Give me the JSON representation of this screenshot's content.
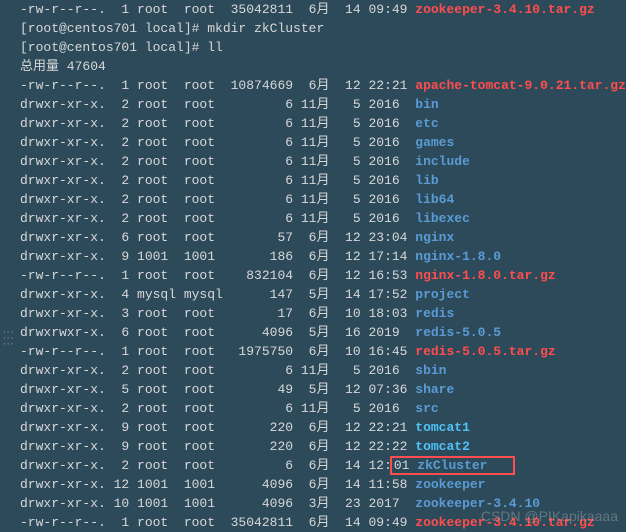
{
  "top_lines": [
    {
      "perms": "-rw-r--r--.",
      "links": "1",
      "owner": "root",
      "group": "root",
      "size": "35042811",
      "month": "6月",
      "day": "14",
      "time": "09:49",
      "name": "zookeeper-3.4.10.tar.gz",
      "cls": "red"
    }
  ],
  "commands": [
    {
      "prompt": "[root@centos701 local]# ",
      "cmd": "mkdir zkCluster"
    },
    {
      "prompt": "[root@centos701 local]# ",
      "cmd": "ll"
    }
  ],
  "total": "总用量 47604",
  "entries": [
    {
      "perms": "-rw-r--r--.",
      "links": "1",
      "owner": "root",
      "group": "root",
      "size": "10874669",
      "month": "6月",
      "day": "12",
      "time": "22:21",
      "name": "apache-tomcat-9.0.21.tar.gz",
      "cls": "red"
    },
    {
      "perms": "drwxr-xr-x.",
      "links": "2",
      "owner": "root",
      "group": "root",
      "size": "6",
      "month": "11月",
      "day": "5",
      "time": "2016",
      "name": "bin",
      "cls": "blue"
    },
    {
      "perms": "drwxr-xr-x.",
      "links": "2",
      "owner": "root",
      "group": "root",
      "size": "6",
      "month": "11月",
      "day": "5",
      "time": "2016",
      "name": "etc",
      "cls": "blue"
    },
    {
      "perms": "drwxr-xr-x.",
      "links": "2",
      "owner": "root",
      "group": "root",
      "size": "6",
      "month": "11月",
      "day": "5",
      "time": "2016",
      "name": "games",
      "cls": "blue"
    },
    {
      "perms": "drwxr-xr-x.",
      "links": "2",
      "owner": "root",
      "group": "root",
      "size": "6",
      "month": "11月",
      "day": "5",
      "time": "2016",
      "name": "include",
      "cls": "blue"
    },
    {
      "perms": "drwxr-xr-x.",
      "links": "2",
      "owner": "root",
      "group": "root",
      "size": "6",
      "month": "11月",
      "day": "5",
      "time": "2016",
      "name": "lib",
      "cls": "blue"
    },
    {
      "perms": "drwxr-xr-x.",
      "links": "2",
      "owner": "root",
      "group": "root",
      "size": "6",
      "month": "11月",
      "day": "5",
      "time": "2016",
      "name": "lib64",
      "cls": "blue"
    },
    {
      "perms": "drwxr-xr-x.",
      "links": "2",
      "owner": "root",
      "group": "root",
      "size": "6",
      "month": "11月",
      "day": "5",
      "time": "2016",
      "name": "libexec",
      "cls": "blue"
    },
    {
      "perms": "drwxr-xr-x.",
      "links": "6",
      "owner": "root",
      "group": "root",
      "size": "57",
      "month": "6月",
      "day": "12",
      "time": "23:04",
      "name": "nginx",
      "cls": "blue"
    },
    {
      "perms": "drwxr-xr-x.",
      "links": "9",
      "owner": "1001",
      "group": "1001",
      "size": "186",
      "month": "6月",
      "day": "12",
      "time": "17:14",
      "name": "nginx-1.8.0",
      "cls": "blue"
    },
    {
      "perms": "-rw-r--r--.",
      "links": "1",
      "owner": "root",
      "group": "root",
      "size": "832104",
      "month": "6月",
      "day": "12",
      "time": "16:53",
      "name": "nginx-1.8.0.tar.gz",
      "cls": "red"
    },
    {
      "perms": "drwxr-xr-x.",
      "links": "4",
      "owner": "mysql",
      "group": "mysql",
      "size": "147",
      "month": "5月",
      "day": "14",
      "time": "17:52",
      "name": "project",
      "cls": "blue"
    },
    {
      "perms": "drwxr-xr-x.",
      "links": "3",
      "owner": "root",
      "group": "root",
      "size": "17",
      "month": "6月",
      "day": "10",
      "time": "18:03",
      "name": "redis",
      "cls": "blue"
    },
    {
      "perms": "drwxrwxr-x.",
      "links": "6",
      "owner": "root",
      "group": "root",
      "size": "4096",
      "month": "5月",
      "day": "16",
      "time": "2019",
      "name": "redis-5.0.5",
      "cls": "blue"
    },
    {
      "perms": "-rw-r--r--.",
      "links": "1",
      "owner": "root",
      "group": "root",
      "size": "1975750",
      "month": "6月",
      "day": "10",
      "time": "16:45",
      "name": "redis-5.0.5.tar.gz",
      "cls": "red"
    },
    {
      "perms": "drwxr-xr-x.",
      "links": "2",
      "owner": "root",
      "group": "root",
      "size": "6",
      "month": "11月",
      "day": "5",
      "time": "2016",
      "name": "sbin",
      "cls": "blue"
    },
    {
      "perms": "drwxr-xr-x.",
      "links": "5",
      "owner": "root",
      "group": "root",
      "size": "49",
      "month": "5月",
      "day": "12",
      "time": "07:36",
      "name": "share",
      "cls": "blue"
    },
    {
      "perms": "drwxr-xr-x.",
      "links": "2",
      "owner": "root",
      "group": "root",
      "size": "6",
      "month": "11月",
      "day": "5",
      "time": "2016",
      "name": "src",
      "cls": "blue"
    },
    {
      "perms": "drwxr-xr-x.",
      "links": "9",
      "owner": "root",
      "group": "root",
      "size": "220",
      "month": "6月",
      "day": "12",
      "time": "22:21",
      "name": "tomcat1",
      "cls": "cyan"
    },
    {
      "perms": "drwxr-xr-x.",
      "links": "9",
      "owner": "root",
      "group": "root",
      "size": "220",
      "month": "6月",
      "day": "12",
      "time": "22:22",
      "name": "tomcat2",
      "cls": "cyan"
    },
    {
      "perms": "drwxr-xr-x.",
      "links": "2",
      "owner": "root",
      "group": "root",
      "size": "6",
      "month": "6月",
      "day": "14",
      "time": "12:01",
      "name": "zkCluster",
      "cls": "blue",
      "box": true
    },
    {
      "perms": "drwxr-xr-x.",
      "links": "12",
      "owner": "1001",
      "group": "1001",
      "size": "4096",
      "month": "6月",
      "day": "14",
      "time": "11:58",
      "name": "zookeeper",
      "cls": "blue"
    },
    {
      "perms": "drwxr-xr-x.",
      "links": "10",
      "owner": "1001",
      "group": "1001",
      "size": "4096",
      "month": "3月",
      "day": "23",
      "time": "2017",
      "name": "zookeeper-3.4.10",
      "cls": "blue"
    },
    {
      "perms": "-rw-r--r--.",
      "links": "1",
      "owner": "root",
      "group": "root",
      "size": "35042811",
      "month": "6月",
      "day": "14",
      "time": "09:49",
      "name": "zookeeper-3.4.10.tar.gz",
      "cls": "red"
    }
  ],
  "watermark": "CSDN @PIKapikaaaa"
}
